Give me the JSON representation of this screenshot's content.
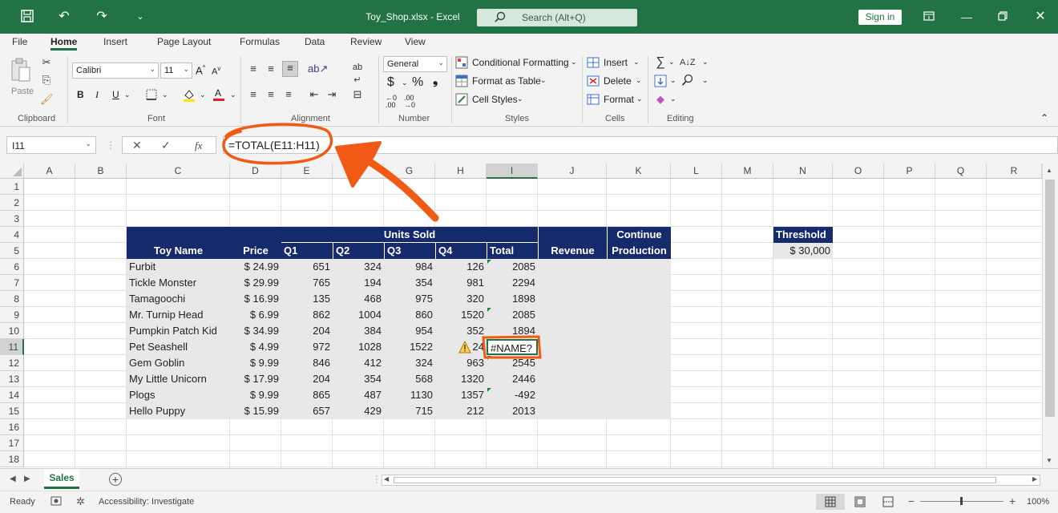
{
  "app": {
    "title": "Toy_Shop.xlsx - Excel",
    "search_placeholder": "Search (Alt+Q)",
    "sign_in": "Sign in"
  },
  "menu": [
    "File",
    "Home",
    "Insert",
    "Page Layout",
    "Formulas",
    "Data",
    "Review",
    "View"
  ],
  "menu_active": "Home",
  "ribbon": {
    "paste": "Paste",
    "font_name": "Calibri",
    "font_size": "11",
    "number_format": "General",
    "conditional_formatting": "Conditional Formatting",
    "format_as_table": "Format as Table",
    "cell_styles": "Cell Styles",
    "insert": "Insert",
    "delete": "Delete",
    "format": "Format",
    "bold": "B",
    "italic": "I",
    "underline": "U",
    "groups": {
      "clipboard": "Clipboard",
      "font": "Font",
      "alignment": "Alignment",
      "number": "Number",
      "styles": "Styles",
      "cells": "Cells",
      "editing": "Editing"
    }
  },
  "formula_bar": {
    "name_box": "I11",
    "formula": "=TOTAL(E11:H11)",
    "fx": "fx"
  },
  "columns": [
    "A",
    "B",
    "C",
    "D",
    "E",
    "F",
    "G",
    "H",
    "I",
    "J",
    "K",
    "L",
    "M",
    "N",
    "O",
    "P",
    "Q",
    "R"
  ],
  "rows": [
    "1",
    "2",
    "3",
    "4",
    "5",
    "6",
    "7",
    "8",
    "9",
    "10",
    "11",
    "12",
    "13",
    "14",
    "15",
    "16",
    "17",
    "18"
  ],
  "table": {
    "header_toy": "Toy Name",
    "header_price": "Price",
    "header_units": "Units Sold",
    "header_q1": "Q1",
    "header_q2": "Q2",
    "header_q3": "Q3",
    "header_q4": "Q4",
    "header_total": "Total",
    "header_revenue": "Revenue",
    "header_continue_1": "Continue",
    "header_continue_2": "Production",
    "header_threshold": "Threshold",
    "threshold_value": "$ 30,000",
    "rows": [
      {
        "name": "Furbit",
        "price": "$ 24.99",
        "q1": "651",
        "q2": "324",
        "q3": "984",
        "q4": "126",
        "total": "2085"
      },
      {
        "name": "Tickle Monster",
        "price": "$ 29.99",
        "q1": "765",
        "q2": "194",
        "q3": "354",
        "q4": "981",
        "total": "2294"
      },
      {
        "name": "Tamagoochi",
        "price": "$ 16.99",
        "q1": "135",
        "q2": "468",
        "q3": "975",
        "q4": "320",
        "total": "1898"
      },
      {
        "name": "Mr. Turnip Head",
        "price": "$ 6.99",
        "q1": "862",
        "q2": "1004",
        "q3": "860",
        "q4": "1520",
        "total": "2085"
      },
      {
        "name": "Pumpkin Patch Kid",
        "price": "$ 34.99",
        "q1": "204",
        "q2": "384",
        "q3": "954",
        "q4": "352",
        "total": "1894"
      },
      {
        "name": "Pet Seashell",
        "price": "$ 4.99",
        "q1": "972",
        "q2": "1028",
        "q3": "1522",
        "q4": "24",
        "total": "#NAME?"
      },
      {
        "name": "Gem Goblin",
        "price": "$ 9.99",
        "q1": "846",
        "q2": "412",
        "q3": "324",
        "q4": "963",
        "total": "2545"
      },
      {
        "name": "My Little Unicorn",
        "price": "$ 17.99",
        "q1": "204",
        "q2": "354",
        "q3": "568",
        "q4": "1320",
        "total": "2446"
      },
      {
        "name": "Plogs",
        "price": "$ 9.99",
        "q1": "865",
        "q2": "487",
        "q3": "1130",
        "q4": "1357",
        "total": "-492"
      },
      {
        "name": "Hello Puppy",
        "price": "$ 15.99",
        "q1": "657",
        "q2": "429",
        "q3": "715",
        "q4": "212",
        "total": "2013"
      }
    ]
  },
  "sheet_tab": "Sales",
  "status": {
    "ready": "Ready",
    "accessibility": "Accessibility: Investigate",
    "zoom": "100%"
  },
  "colors": {
    "excel_green": "#217346",
    "header_navy": "#162b6b",
    "band_gray": "#e8e8e8",
    "annotation_orange": "#f05a14"
  }
}
